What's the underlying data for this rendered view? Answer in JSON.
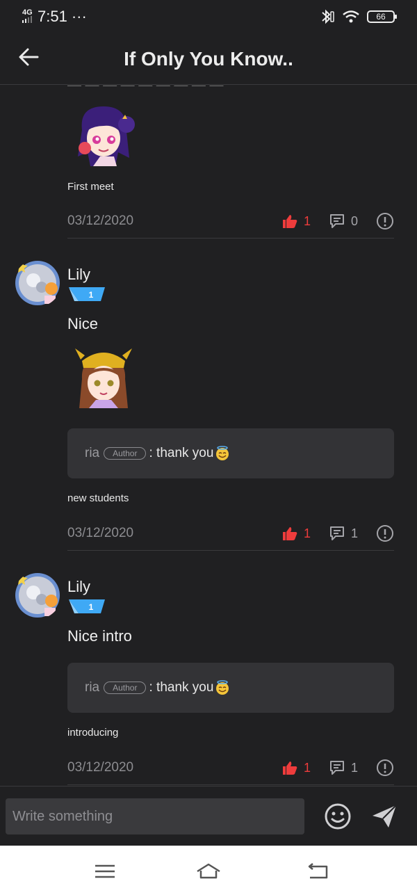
{
  "status": {
    "network": "4G",
    "time": "7:51",
    "dots": "···",
    "battery": "66"
  },
  "header": {
    "title": "If Only You Know.."
  },
  "feed": {
    "cut_text": "... playing ... ... ... ... ...",
    "posts": [
      {
        "caption": "First meet",
        "date": "03/12/2020",
        "likes": "1",
        "comments": "0"
      },
      {
        "author": "Lily",
        "level": "1",
        "text": "Nice",
        "reply": {
          "name": "ria",
          "tag": "Author",
          "text": ": thank you"
        },
        "caption": "new students",
        "date": "03/12/2020",
        "likes": "1",
        "comments": "1"
      },
      {
        "author": "Lily",
        "level": "1",
        "text": "Nice intro",
        "reply": {
          "name": "ria",
          "tag": "Author",
          "text": ": thank you"
        },
        "caption": "introducing",
        "date": "03/12/2020",
        "likes": "1",
        "comments": "1"
      }
    ]
  },
  "composer": {
    "placeholder": "Write something"
  },
  "icons": {
    "back": "arrow-left-icon",
    "like": "thumbs-up-icon",
    "comment": "comment-icon",
    "report": "info-icon",
    "emoji": "smile-icon",
    "send": "send-icon"
  },
  "colors": {
    "background": "#202022",
    "like": "#ee3c3c",
    "level_badge": "#3fa9f5"
  }
}
